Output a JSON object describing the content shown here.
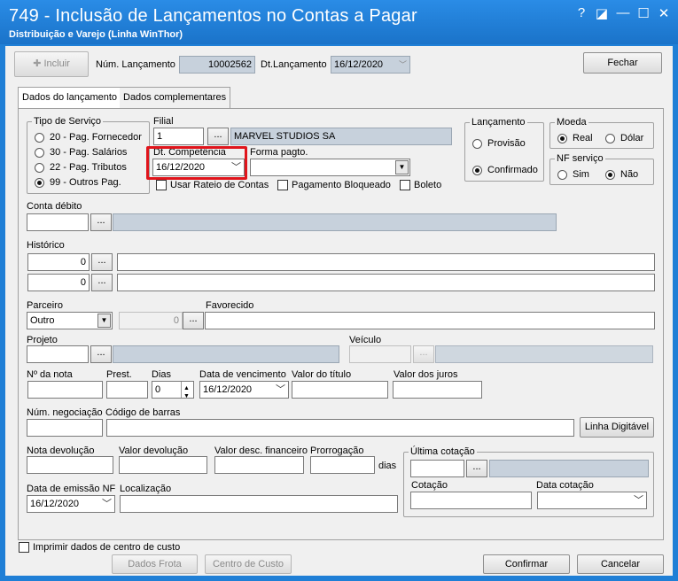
{
  "window": {
    "title": "749 - Inclusão de Lançamentos no Contas a Pagar",
    "subtitle": "Distribuição e Varejo (Linha WinThor)",
    "controls": {
      "help": "?",
      "restore": "◪",
      "minimize": "—",
      "maximize": "☐",
      "close": "✕"
    }
  },
  "toolbar": {
    "incluir_label": "Incluir",
    "incluir_icon": "plus-icon",
    "num_lancamento_label": "Núm. Lançamento",
    "num_lancamento_value": "10002562",
    "dt_lancamento_label": "Dt.Lançamento",
    "dt_lancamento_value": "16/12/2020",
    "fechar_label": "Fechar"
  },
  "tabs": [
    {
      "label": "Dados do lançamento",
      "active": true
    },
    {
      "label": "Dados complementares",
      "active": false
    }
  ],
  "tipo_servico": {
    "title": "Tipo de Serviço",
    "options": [
      {
        "label": "20 - Pag. Fornecedor",
        "selected": false
      },
      {
        "label": "30 - Pag. Salários",
        "selected": false
      },
      {
        "label": "22 - Pag. Tributos",
        "selected": false
      },
      {
        "label": "99 - Outros Pag.",
        "selected": true
      }
    ]
  },
  "filial": {
    "label": "Filial",
    "code": "1",
    "name": "MARVEL STUDIOS SA"
  },
  "dt_competencia": {
    "label": "Dt. Competência",
    "value": "16/12/2020"
  },
  "forma_pagto": {
    "label": "Forma pagto.",
    "value": ""
  },
  "checkboxes": {
    "rateio": "Usar Rateio de Contas",
    "bloqueado": "Pagamento Bloqueado",
    "boleto": "Boleto"
  },
  "lancamento": {
    "title": "Lançamento",
    "options": [
      {
        "label": "Provisão",
        "selected": false
      },
      {
        "label": "Confirmado",
        "selected": true
      }
    ]
  },
  "moeda": {
    "title": "Moeda",
    "options": [
      {
        "label": "Real",
        "selected": true
      },
      {
        "label": "Dólar",
        "selected": false
      }
    ]
  },
  "nf_servico": {
    "title": "NF serviço",
    "options": [
      {
        "label": "Sim",
        "selected": false
      },
      {
        "label": "Não",
        "selected": true
      }
    ]
  },
  "conta_debito": {
    "label": "Conta débito",
    "value": ""
  },
  "historico": {
    "label": "Histórico",
    "line1_code": "0",
    "line2_code": "0"
  },
  "parceiro": {
    "label": "Parceiro",
    "value": "Outro",
    "code": "0"
  },
  "favorecido": {
    "label": "Favorecido",
    "value": ""
  },
  "projeto": {
    "label": "Projeto",
    "value": ""
  },
  "veiculo": {
    "label": "Veículo",
    "value": ""
  },
  "row_nota": {
    "num_nota_label": "Nº da nota",
    "prest_label": "Prest.",
    "dias_label": "Dias",
    "dias_value": "0",
    "vencimento_label": "Data de vencimento",
    "vencimento_value": "16/12/2020",
    "valor_titulo_label": "Valor do título",
    "valor_juros_label": "Valor dos juros"
  },
  "row_negociacao": {
    "num_negociacao_label": "Núm. negociação",
    "codigo_barras_label": "Código de barras",
    "linha_digitavel_label": "Linha Digitável"
  },
  "row_devolucao": {
    "nota_devolucao_label": "Nota devolução",
    "valor_devolucao_label": "Valor devolução",
    "valor_desc_label": "Valor desc. financeiro",
    "prorrogacao_label": "Prorrogação",
    "dias_label": "dias"
  },
  "ultima_cotacao": {
    "title": "Última cotação",
    "cotacao_label": "Cotação",
    "data_cotacao_label": "Data cotação"
  },
  "row_emissao": {
    "data_emissao_label": "Data de emissão NF",
    "data_emissao_value": "16/12/2020",
    "localizacao_label": "Localização"
  },
  "footer": {
    "imprimir_label": "Imprimir dados de centro de custo",
    "dados_frota_label": "Dados Frota",
    "centro_custo_label": "Centro de Custo",
    "confirmar_label": "Confirmar",
    "cancelar_label": "Cancelar"
  },
  "colors": {
    "titlebar": "#1f7fd6",
    "highlight": "#e0141b",
    "readonly_field": "#c7d1dc"
  }
}
